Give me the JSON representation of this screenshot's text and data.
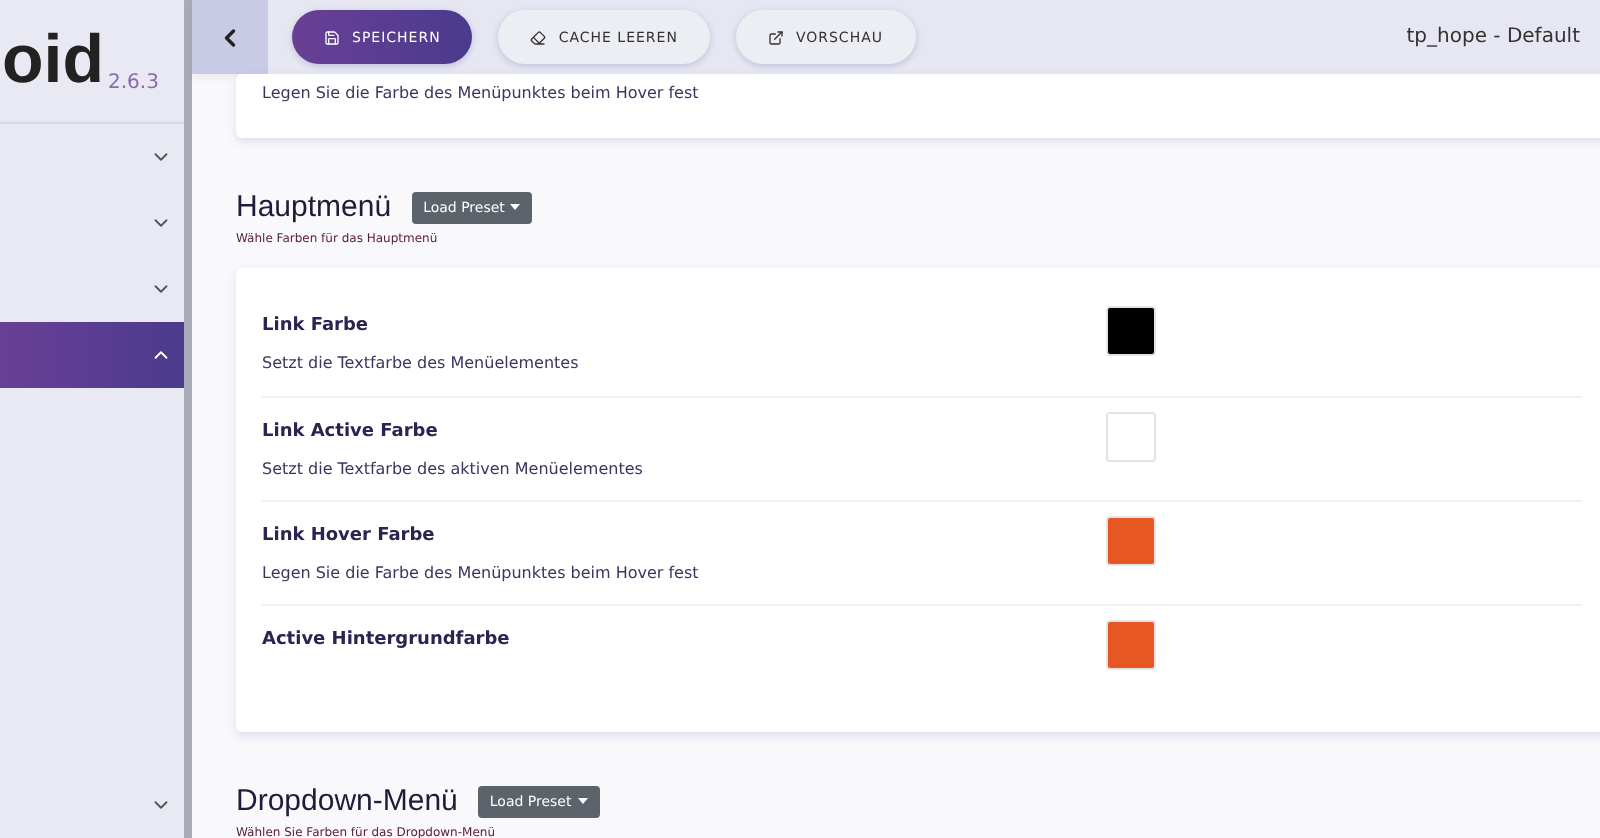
{
  "sidebar": {
    "logo": "oid",
    "version": "2.6.3",
    "items": [
      {
        "expanded": false,
        "selected": false
      },
      {
        "expanded": false,
        "selected": false
      },
      {
        "expanded": false,
        "selected": false
      },
      {
        "expanded": true,
        "selected": true
      },
      {
        "expanded": false,
        "selected": false
      }
    ]
  },
  "toolbar": {
    "buttons": [
      {
        "label": "SPEICHERN",
        "kind": "primary"
      },
      {
        "label": "CACHE LEEREN",
        "kind": "eraser"
      },
      {
        "label": "VORSCHAU",
        "kind": "external"
      }
    ],
    "template": "tp_hope - Default"
  },
  "top_card": {
    "description": "Legen Sie die Farbe des Menüpunktes beim Hover fest"
  },
  "sections": [
    {
      "title": "Hauptmenü",
      "preset_button": "Load Preset",
      "subtitle": "Wähle Farben für das Hauptmenü",
      "rows": [
        {
          "label": "Link Farbe",
          "description": "Setzt die Textfarbe des Menüelementes",
          "color": "#000000"
        },
        {
          "label": "Link Active Farbe",
          "description": "Setzt die Textfarbe des aktiven Menüelementes",
          "color": "#ffffff"
        },
        {
          "label": "Link Hover Farbe",
          "description": "Legen Sie die Farbe des Menüpunktes beim Hover fest",
          "color": "#e65722"
        },
        {
          "label": "Active Hintergrundfarbe",
          "color": "#e65722"
        }
      ]
    },
    {
      "title": "Dropdown-Menü",
      "preset_button": "Load Preset",
      "subtitle": "Wählen Sie Farben für das Dropdown-Menü"
    }
  ]
}
